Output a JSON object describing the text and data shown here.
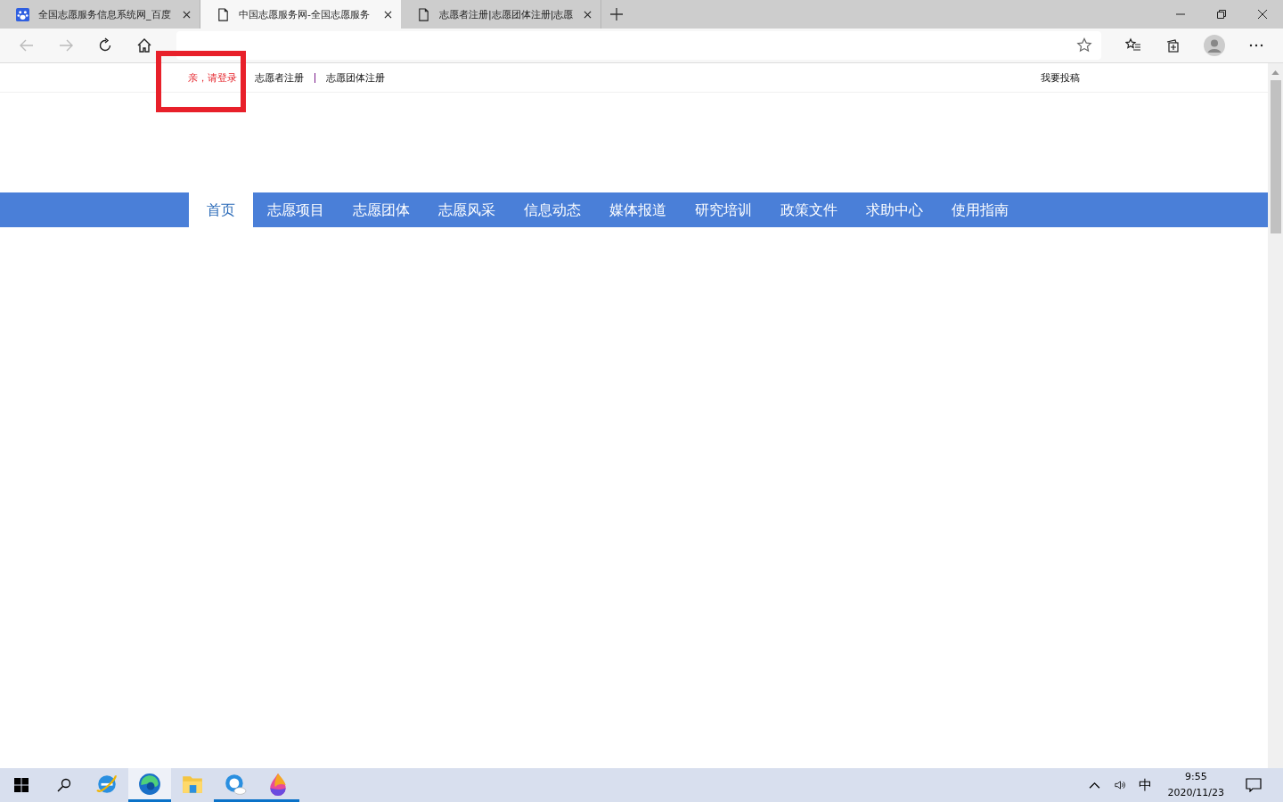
{
  "tabs": [
    {
      "title": "全国志愿服务信息系统网_百度",
      "kind": "search",
      "selected": false
    },
    {
      "title": "中国志愿服务网-全国志愿服务",
      "kind": "page",
      "selected": true
    },
    {
      "title": "志愿者注册|志愿团体注册|志愿",
      "kind": "page",
      "selected": false
    }
  ],
  "topbar": {
    "login": "亲，请登录",
    "links": [
      "志愿者注册",
      "志愿团体注册"
    ],
    "contribute": "我要投稿"
  },
  "nav": [
    {
      "label": "首页",
      "selected": true
    },
    {
      "label": "志愿项目",
      "selected": false
    },
    {
      "label": "志愿团体",
      "selected": false
    },
    {
      "label": "志愿风采",
      "selected": false
    },
    {
      "label": "信息动态",
      "selected": false
    },
    {
      "label": "媒体报道",
      "selected": false
    },
    {
      "label": "研究培训",
      "selected": false
    },
    {
      "label": "政策文件",
      "selected": false
    },
    {
      "label": "求助中心",
      "selected": false
    },
    {
      "label": "使用指南",
      "selected": false
    }
  ],
  "taskbar": {
    "apps": [
      {
        "kind": "ie",
        "running": false,
        "selected": false
      },
      {
        "kind": "edge",
        "running": true,
        "selected": true
      },
      {
        "kind": "folder",
        "running": false,
        "selected": false
      },
      {
        "kind": "cloud",
        "running": true,
        "selected": false
      },
      {
        "kind": "drop",
        "running": true,
        "selected": false
      }
    ],
    "ime": "中",
    "time": "9:55",
    "date": "2020/11/23"
  }
}
